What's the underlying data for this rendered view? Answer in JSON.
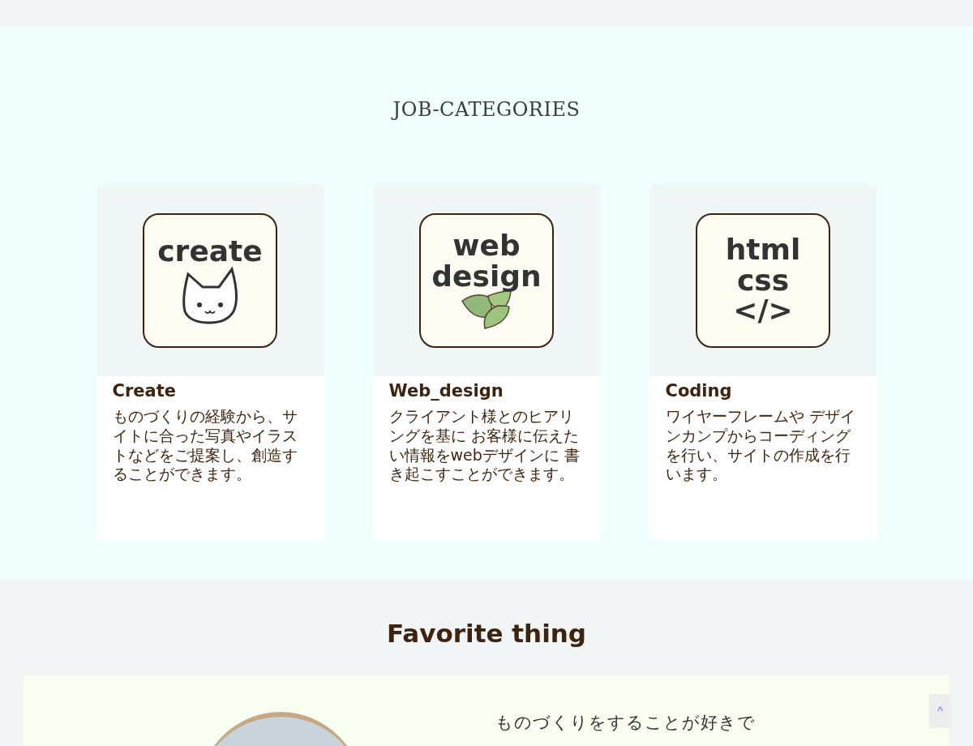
{
  "jobs": {
    "title": "JOB-CATEGORIES",
    "cards": [
      {
        "kind": "cat",
        "image_text": [
          "create"
        ],
        "title": "Create",
        "text": "ものづくりの経験から、サイトに合った写真やイラストなどをご提案し、創造することができます。"
      },
      {
        "kind": "leaves",
        "image_text": [
          "web",
          "design"
        ],
        "title": "Web_design",
        "text": "クライアント様とのヒアリングを基に お客様に伝えたい情報をwebデザインに 書き起こすことができます。"
      },
      {
        "kind": "code",
        "image_text": [
          "html",
          "css",
          "</>"
        ],
        "title": "Coding",
        "text": "ワイヤーフレームや デザインカンプからコーディングを行い、サイトの作成を行います。"
      }
    ]
  },
  "favorite": {
    "title": "Favorite thing",
    "text": "ものづくりをすることが好きで"
  },
  "scroll_top": "^"
}
